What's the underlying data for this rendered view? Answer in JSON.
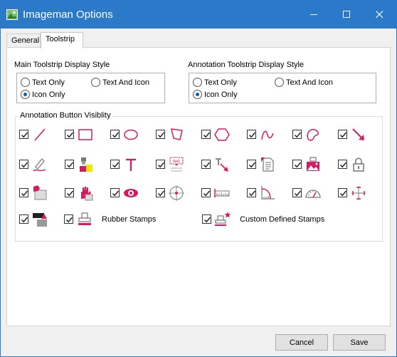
{
  "window": {
    "title": "Imageman Options"
  },
  "tabs": [
    {
      "label": "General"
    },
    {
      "label": "Toolstrip"
    }
  ],
  "main_style": {
    "label": "Main Toolstrip Display Style",
    "options": [
      {
        "label": "Text Only",
        "selected": false
      },
      {
        "label": "Text And Icon",
        "selected": false
      },
      {
        "label": "Icon Only",
        "selected": true
      }
    ]
  },
  "annotation_style": {
    "label": "Annotation Toolstrip Display Style",
    "options": [
      {
        "label": "Text Only",
        "selected": false
      },
      {
        "label": "Text And Icon",
        "selected": false
      },
      {
        "label": "Icon Only",
        "selected": true
      }
    ]
  },
  "visibility": {
    "title": "Annotation Button Visiblity",
    "items": [
      {
        "icon": "line-icon",
        "checked": true
      },
      {
        "icon": "rectangle-icon",
        "checked": true
      },
      {
        "icon": "ellipse-icon",
        "checked": true
      },
      {
        "icon": "polygon-icon",
        "checked": true
      },
      {
        "icon": "hexagon-icon",
        "checked": true
      },
      {
        "icon": "freehand-icon",
        "checked": true
      },
      {
        "icon": "closed-freehand-icon",
        "checked": true
      },
      {
        "icon": "arrow-icon",
        "checked": true
      },
      {
        "icon": "pen-icon",
        "checked": true
      },
      {
        "icon": "highlighter-icon",
        "checked": true
      },
      {
        "icon": "text-icon",
        "checked": true
      },
      {
        "icon": "text-callout-icon",
        "checked": true
      },
      {
        "icon": "text-arrow-icon",
        "checked": true
      },
      {
        "icon": "note-icon",
        "checked": true
      },
      {
        "icon": "image-stamp-icon",
        "checked": true
      },
      {
        "icon": "lock-icon",
        "checked": true
      },
      {
        "icon": "area-fill-icon",
        "checked": true
      },
      {
        "icon": "hand-highlight-icon",
        "checked": true
      },
      {
        "icon": "eye-redact-icon",
        "checked": true
      },
      {
        "icon": "crosshair-point-icon",
        "checked": true
      },
      {
        "icon": "ruler-icon",
        "checked": true
      },
      {
        "icon": "angle-measure-icon",
        "checked": true
      },
      {
        "icon": "protractor-icon",
        "checked": true
      },
      {
        "icon": "crosshair-move-icon",
        "checked": true
      },
      {
        "icon": "redact-block-icon",
        "checked": true
      }
    ],
    "rubber_stamps": {
      "icon": "rubber-stamp-icon",
      "label": "Rubber Stamps",
      "checked": true
    },
    "custom_stamps": {
      "icon": "custom-stamp-icon",
      "label": "Custom Defined Stamps",
      "checked": true
    }
  },
  "buttons": {
    "cancel": "Cancel",
    "save": "Save"
  },
  "colors": {
    "accent": "#2b79c9",
    "icon": "#d81b60"
  }
}
